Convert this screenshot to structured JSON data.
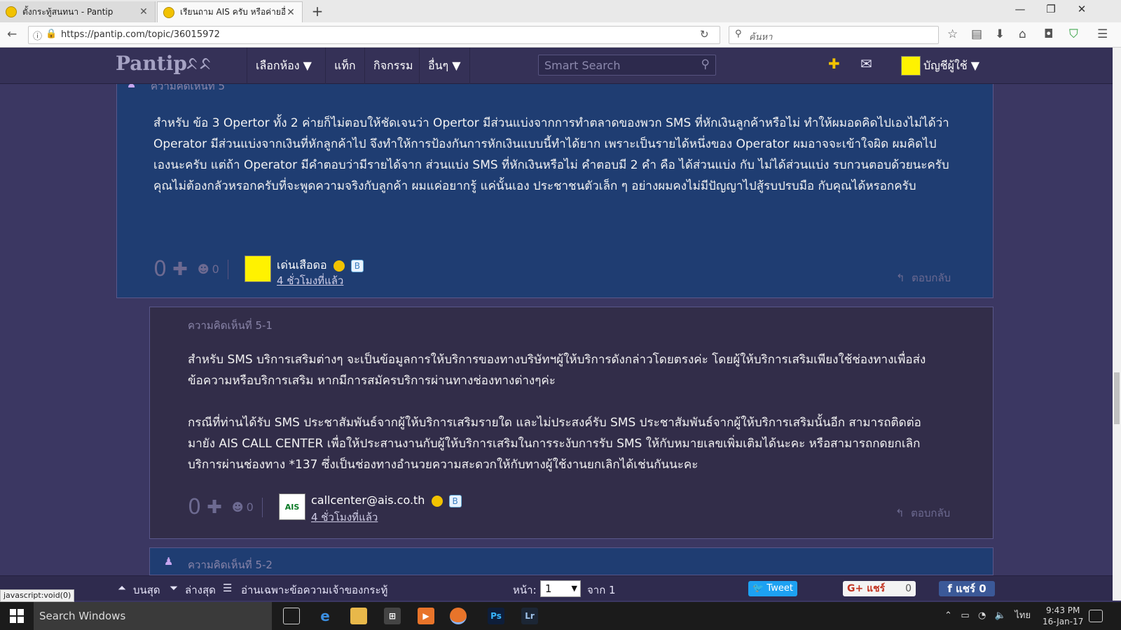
{
  "browser": {
    "tabs": [
      {
        "title": "ตั้งกระทู้สนทนา - Pantip"
      },
      {
        "title": "เรียนถาม AIS ครับ หรือค่ายอื่..."
      }
    ],
    "new_tab": "+",
    "url": "https://pantip.com/topic/36015972",
    "search_placeholder": "ค้นหา",
    "status_text": "javascript:void(0)"
  },
  "site": {
    "logo": "Pantip",
    "logo_mark": "ᨅᨅ",
    "menu": [
      {
        "label": "เลือกห้อง ▼"
      },
      {
        "label": "แท็ก"
      },
      {
        "label": "กิจกรรม"
      },
      {
        "label": "อื่นๆ ▼"
      }
    ],
    "smart_search_placeholder": "Smart Search",
    "account_label": "บัญชีผู้ใช้ ▼"
  },
  "comments": [
    {
      "header": "ความคิดเห็นที่ 5",
      "paragraphs": [
        "สำหรับ ข้อ 3  Opertor ทั้ง 2 ค่ายก็ไม่ตอบให้ชัดเจนว่า Opertor มีส่วนแบ่งจากการทำตลาดของพวก  SMS ที่หักเงินลูกค้าหรือไม่ ทำให้ผมอดคิดไปเองไม่ได้ว่า Operator มีส่วนแบ่งจากเงินที่หักลูกค้าไป จึงทำให้การป้องกันการหักเงินแบบนี้ทำได้ยาก เพราะเป็นรายได้หนึ่งของ Operator ผมอาจจะเข้าใจผิด ผมคิดไปเองนะครับ แต่ถ้า Operator มีคำตอบว่ามีรายได้จาก ส่วนแบ่ง SMS ที่หักเงินหรือไม่ คำตอบมี 2 คำ คือ ได้ส่วนแบ่ง  กับ ไม่ได้ส่วนแบ่ง รบกวนตอบด้วยนะครับ",
        "คุณไม่ต้องกลัวหรอกครับที่จะพูดความจริงกับลูกค้า ผมแค่อยากรู้ แค่นั้นเอง ประชาชนตัวเล็ก ๆ อย่างผมคงไม่มีปัญญาไปสู้รบปรบมือ กับคุณได้หรอกครับ"
      ],
      "votes": "0",
      "emotions": "0",
      "user": "เด่นเสือดอ",
      "time": "4 ชั่วโมงที่แล้ว",
      "reply": "ตอบกลับ"
    },
    {
      "header": "ความคิดเห็นที่ 5-1",
      "paragraphs": [
        "สำหรับ SMS บริการเสริมต่างๆ จะเป็นข้อมูลการให้บริการของทางบริษัทฯผู้ให้บริการดังกล่าวโดยตรงค่ะ โดยผู้ให้บริการเสริมเพียงใช้ช่องทางเพื่อส่งข้อความหรือบริการเสริม หากมีการสมัครบริการผ่านทางช่องทางต่างๆค่ะ",
        "กรณีที่ท่านได้รับ SMS ประชาสัมพันธ์จากผู้ให้บริการเสริมรายใด และไม่ประสงค์รับ SMS ประชาสัมพันธ์จากผู้ให้บริการเสริมนั้นอีก สามารถติดต่อมายัง AIS CALL CENTER เพื่อให้ประสานงานกับผู้ให้บริการเสริมในการระงับการรับ SMS ให้กับหมายเลขเพิ่มเติมได้นะคะ หรือสามารถกดยกเลิกบริการผ่านช่องทาง *137 ซึ่งเป็นช่องทางอำนวยความสะดวกให้กับทางผู้ใช้งานยกเลิกได้เช่นกันนะคะ"
      ],
      "votes": "0",
      "emotions": "0",
      "user": "callcenter@ais.co.th",
      "avatar_text": "AIS",
      "time": "4 ชั่วโมงที่แล้ว",
      "reply": "ตอบกลับ"
    },
    {
      "header": "ความคิดเห็นที่ 5-2"
    }
  ],
  "pagebar": {
    "top": "บนสุด",
    "bottom": "ล่างสุด",
    "owner_only": "อ่านเฉพาะข้อความเจ้าของกระทู้",
    "page_label": "หน้า:",
    "page_value": "1",
    "of_label": "จาก 1",
    "tweet": "Tweet",
    "gshare": "แชร์",
    "gshare_count": "0",
    "fbshare": "แชร์ 0"
  },
  "taskbar": {
    "search": "Search Windows",
    "lang": "ไทย",
    "time": "9:43 PM",
    "date": "16-Jan-17"
  }
}
